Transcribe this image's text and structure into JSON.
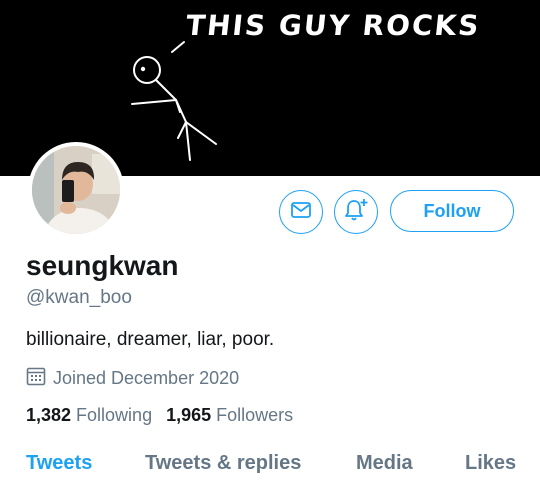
{
  "banner": {
    "caption": "THIS GUY ROCKS"
  },
  "profile": {
    "display_name": "seungkwan",
    "handle": "@kwan_boo",
    "bio": "billionaire, dreamer, liar, poor.",
    "joined": "Joined December 2020",
    "following_count": "1,382",
    "following_label": "Following",
    "followers_count": "1,965",
    "followers_label": "Followers"
  },
  "actions": {
    "follow_label": "Follow",
    "message_icon": "mail-icon",
    "notify_icon": "bell-plus-icon"
  },
  "tabs": [
    {
      "label": "Tweets",
      "active": true
    },
    {
      "label": "Tweets & replies",
      "active": false
    },
    {
      "label": "Media",
      "active": false
    },
    {
      "label": "Likes",
      "active": false
    }
  ],
  "colors": {
    "accent": "#1da1f2",
    "secondary_text": "#657786",
    "primary_text": "#14171a",
    "banner_bg": "#000000"
  }
}
